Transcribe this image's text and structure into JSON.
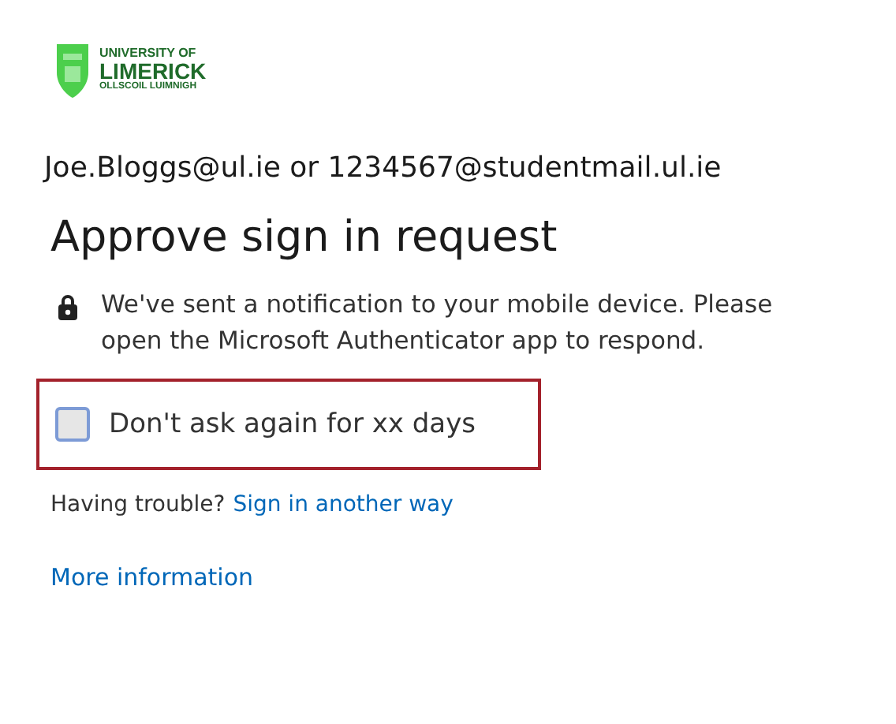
{
  "logo": {
    "lines": [
      "UNIVERSITY OF",
      "LIMERICK",
      "OLLSCOIL LUIMNIGH"
    ]
  },
  "account": "Joe.Bloggs@ul.ie or 1234567@studentmail.ul.ie",
  "title": "Approve sign in request",
  "message": "We've sent a notification to your mobile device. Please open the Microsoft Authenticator app to respond.",
  "remember": {
    "label": "Don't ask again for xx days",
    "checked": false,
    "highlighted": true
  },
  "trouble": {
    "text": "Having trouble?",
    "link": "Sign in another way"
  },
  "more_link": "More information"
}
